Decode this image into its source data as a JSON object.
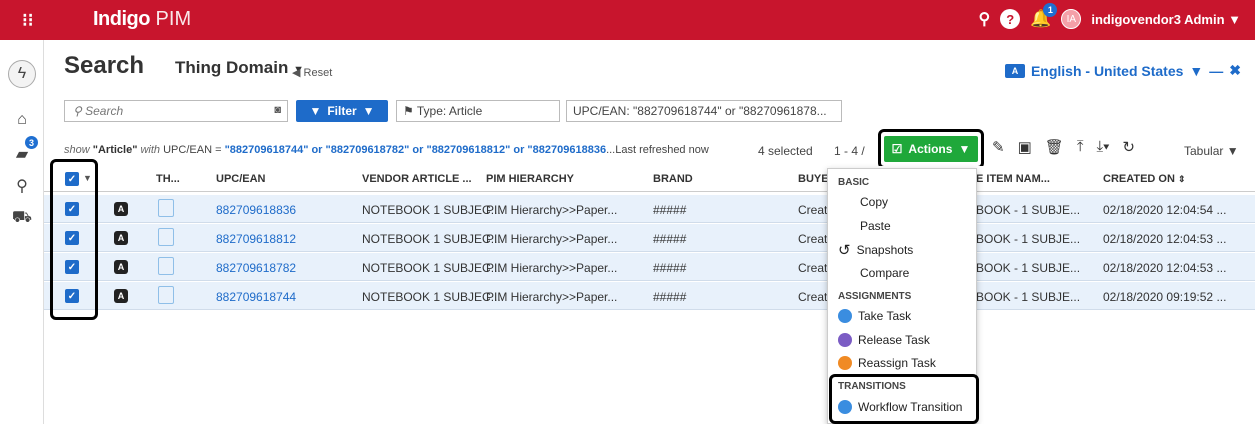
{
  "app": {
    "brand_bold": "Indigo",
    "brand_light": "PIM",
    "user": "indigovendor3 Admin",
    "avatar_initials": "IA",
    "bell_badge": "1"
  },
  "rail": {
    "chat_badge": "3"
  },
  "header": {
    "title": "Search",
    "domain": "Thing Domain",
    "reset": "Reset",
    "language": "English - United States"
  },
  "filters": {
    "search_placeholder": "Search",
    "filter_label": "Filter",
    "type_chip": "Type: Article",
    "upc_chip": "UPC/EAN: \"882709618744\" or \"88270961878..."
  },
  "query": {
    "show": "show",
    "type": "\"Article\"",
    "with": "with",
    "field": "UPC/EAN =",
    "values": "\"882709618744\" or \"882709618782\" or \"882709618812\" or \"882709618836",
    "refreshed": "...Last refreshed now",
    "selected": "4 selected",
    "paging": "1 - 4 /",
    "actions": "Actions",
    "view": "Tabular"
  },
  "table": {
    "headers": [
      "TH...",
      "UPC/EAN",
      "VENDOR ARTICLE ...",
      "PIM HIERARCHY",
      "BRAND",
      "BUYE",
      "E ITEM NAM...",
      "CREATED ON"
    ],
    "rows": [
      {
        "badge": "A",
        "upc": "882709618836",
        "vendor": "NOTEBOOK 1 SUBJEC...",
        "hierarchy": "PIM Hierarchy>>Paper...",
        "brand": "#####",
        "buyer": "Creat",
        "item": "BOOK - 1 SUBJE...",
        "created": "02/18/2020 12:04:54 ..."
      },
      {
        "badge": "A",
        "upc": "882709618812",
        "vendor": "NOTEBOOK 1 SUBJEC...",
        "hierarchy": "PIM Hierarchy>>Paper...",
        "brand": "#####",
        "buyer": "Creat",
        "item": "BOOK - 1 SUBJE...",
        "created": "02/18/2020 12:04:53 ..."
      },
      {
        "badge": "A",
        "upc": "882709618782",
        "vendor": "NOTEBOOK 1 SUBJEC...",
        "hierarchy": "PIM Hierarchy>>Paper...",
        "brand": "#####",
        "buyer": "Creat",
        "item": "BOOK - 1 SUBJE...",
        "created": "02/18/2020 12:04:53 ..."
      },
      {
        "badge": "A",
        "upc": "882709618744",
        "vendor": "NOTEBOOK 1 SUBJEC...",
        "hierarchy": "PIM Hierarchy>>Paper...",
        "brand": "#####",
        "buyer": "Creat",
        "item": "BOOK - 1 SUBJE...",
        "created": "02/18/2020 09:19:52 ..."
      }
    ]
  },
  "menu": {
    "basic": "BASIC",
    "copy": "Copy",
    "paste": "Paste",
    "snapshots": "Snapshots",
    "compare": "Compare",
    "assignments": "ASSIGNMENTS",
    "take": "Take Task",
    "release": "Release Task",
    "reassign": "Reassign Task",
    "transitions": "TRANSITIONS",
    "workflow": "Workflow Transition"
  },
  "colors": {
    "topbar": "#c8152d",
    "accent": "#1e6bc9",
    "actions": "#1fa83a",
    "row": "#e8f1fb"
  }
}
